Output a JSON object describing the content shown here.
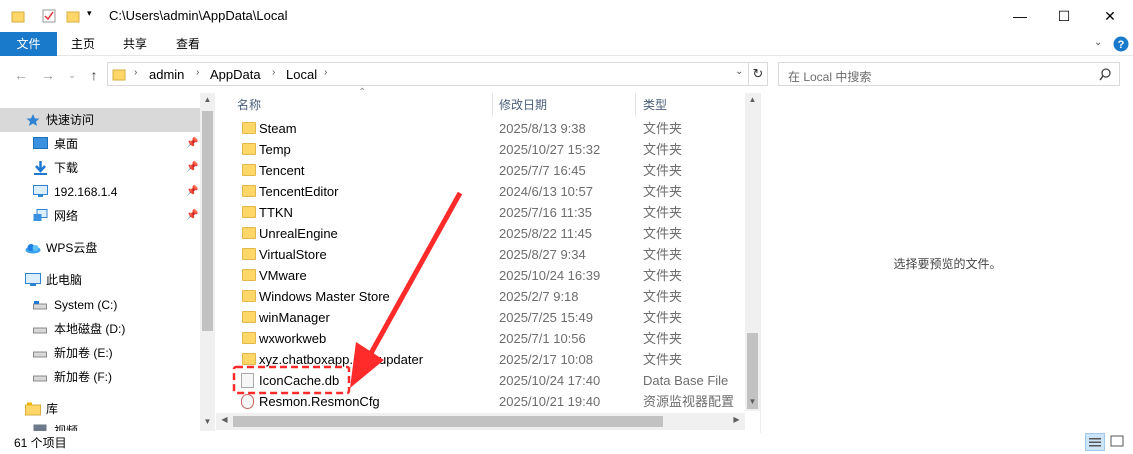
{
  "window": {
    "title": "C:\\Users\\admin\\AppData\\Local",
    "minimize": "—",
    "maximize": "☐",
    "close": "✕"
  },
  "ribbon": {
    "tabs": [
      "文件",
      "主页",
      "共享",
      "查看"
    ]
  },
  "address": {
    "segments": [
      "admin",
      "AppData",
      "Local"
    ],
    "search_placeholder": "在 Local 中搜索"
  },
  "nav": {
    "items": [
      {
        "label": "快速访问",
        "icon": "star-icon"
      },
      {
        "label": "桌面",
        "icon": "desktop-icon"
      },
      {
        "label": "下载",
        "icon": "download-icon"
      },
      {
        "label": "192.168.1.4",
        "icon": "monitor-icon"
      },
      {
        "label": "网络",
        "icon": "network-icon"
      },
      {
        "label": "WPS云盘",
        "icon": "cloud-icon"
      },
      {
        "label": "此电脑",
        "icon": "computer-icon"
      },
      {
        "label": "System (C:)",
        "icon": "drive-icon"
      },
      {
        "label": "本地磁盘 (D:)",
        "icon": "drive-icon"
      },
      {
        "label": "新加卷 (E:)",
        "icon": "drive-icon"
      },
      {
        "label": "新加卷 (F:)",
        "icon": "drive-icon"
      },
      {
        "label": "库",
        "icon": "library-icon"
      },
      {
        "label": "视频",
        "icon": "video-icon"
      }
    ]
  },
  "columns": {
    "name": "名称",
    "date": "修改日期",
    "type": "类型"
  },
  "files": [
    {
      "name": "Steam",
      "date": "2025/8/13 9:38",
      "type": "文件夹",
      "kind": "folder"
    },
    {
      "name": "Temp",
      "date": "2025/10/27 15:32",
      "type": "文件夹",
      "kind": "folder"
    },
    {
      "name": "Tencent",
      "date": "2025/7/7 16:45",
      "type": "文件夹",
      "kind": "folder"
    },
    {
      "name": "TencentEditor",
      "date": "2024/6/13 10:57",
      "type": "文件夹",
      "kind": "folder"
    },
    {
      "name": "TTKN",
      "date": "2025/7/16 11:35",
      "type": "文件夹",
      "kind": "folder"
    },
    {
      "name": "UnrealEngine",
      "date": "2025/8/22 11:45",
      "type": "文件夹",
      "kind": "folder"
    },
    {
      "name": "VirtualStore",
      "date": "2025/8/27 9:34",
      "type": "文件夹",
      "kind": "folder"
    },
    {
      "name": "VMware",
      "date": "2025/10/24 16:39",
      "type": "文件夹",
      "kind": "folder"
    },
    {
      "name": "Windows Master Store",
      "date": "2025/2/7 9:18",
      "type": "文件夹",
      "kind": "folder"
    },
    {
      "name": "winManager",
      "date": "2025/7/25 15:49",
      "type": "文件夹",
      "kind": "folder"
    },
    {
      "name": "wxworkweb",
      "date": "2025/7/1 10:56",
      "type": "文件夹",
      "kind": "folder"
    },
    {
      "name": "xyz.chatboxapp.app-updater",
      "date": "2025/2/17 10:08",
      "type": "文件夹",
      "kind": "folder"
    },
    {
      "name": "IconCache.db",
      "date": "2025/10/24 17:40",
      "type": "Data Base File",
      "kind": "file"
    },
    {
      "name": "Resmon.ResmonCfg",
      "date": "2025/10/21 19:40",
      "type": "资源监视器配置",
      "kind": "cfg"
    }
  ],
  "preview": {
    "message": "选择要预览的文件。"
  },
  "status": {
    "count": "61 个项目"
  },
  "colors": {
    "accent": "#1979ca",
    "highlight_red": "#ff2a2a",
    "folder": "#ffd768"
  }
}
